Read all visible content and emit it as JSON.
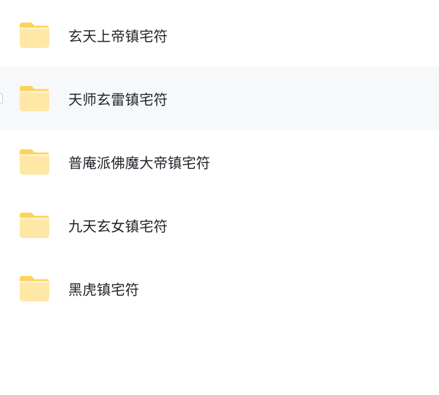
{
  "file_list": {
    "items": [
      {
        "type": "folder",
        "icon": "folder-icon",
        "name": "玄天上帝镇宅符",
        "hovered": false
      },
      {
        "type": "folder",
        "icon": "folder-icon",
        "name": "天师玄雷镇宅符",
        "hovered": true
      },
      {
        "type": "folder",
        "icon": "folder-icon",
        "name": "普庵派佛魔大帝镇宅符",
        "hovered": false
      },
      {
        "type": "folder",
        "icon": "folder-icon",
        "name": "九天玄女镇宅符",
        "hovered": false
      },
      {
        "type": "folder",
        "icon": "folder-icon",
        "name": "黑虎镇宅符",
        "hovered": false
      }
    ]
  },
  "colors": {
    "hover_background": "#f7f8fa",
    "folder_light": "#ffe7a6",
    "folder_dark": "#ffd25c",
    "text": "#1f2329"
  }
}
